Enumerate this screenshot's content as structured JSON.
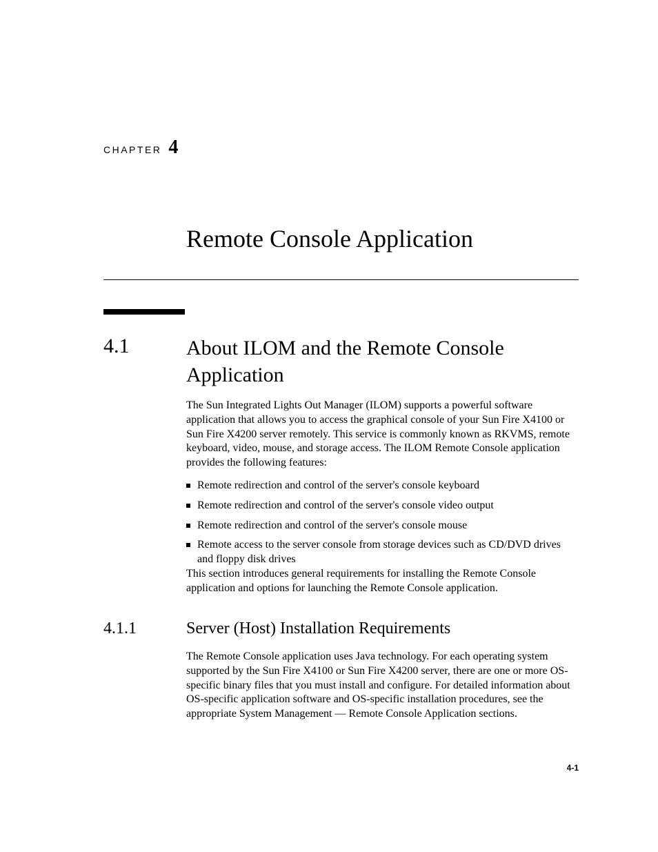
{
  "chapter": {
    "label": "CHAPTER",
    "number": "4"
  },
  "title": "Remote Console Application",
  "section1": {
    "number": "4.1",
    "heading": "About ILOM and the Remote Console Application",
    "para1": "The Sun Integrated Lights Out Manager (ILOM) supports a powerful software application that allows you to access the graphical console of your Sun Fire X4100 or Sun Fire X4200 server remotely. This service is commonly known as RKVMS, remote keyboard, video, mouse, and storage access. The ILOM Remote Console application provides the following features:",
    "bullets": [
      "Remote redirection and control of the server's console keyboard",
      "Remote redirection and control of the server's console video output",
      "Remote redirection and control of the server's console mouse",
      "Remote access to the server console from storage devices such as CD/DVD drives and floppy disk drives"
    ],
    "para2": "This section introduces general requirements for installing the Remote Console application and options for launching the Remote Console application."
  },
  "section2": {
    "number": "4.1.1",
    "heading": "Server (Host) Installation Requirements",
    "para1": "The Remote Console application uses Java technology. For each operating system supported by the Sun Fire X4100 or Sun Fire X4200 server, there are one or more OS-specific binary files that you must install and configure. For detailed information about OS-specific application software and OS-specific installation procedures, see the appropriate System Management — Remote Console Application sections."
  },
  "page_number": "4-1"
}
